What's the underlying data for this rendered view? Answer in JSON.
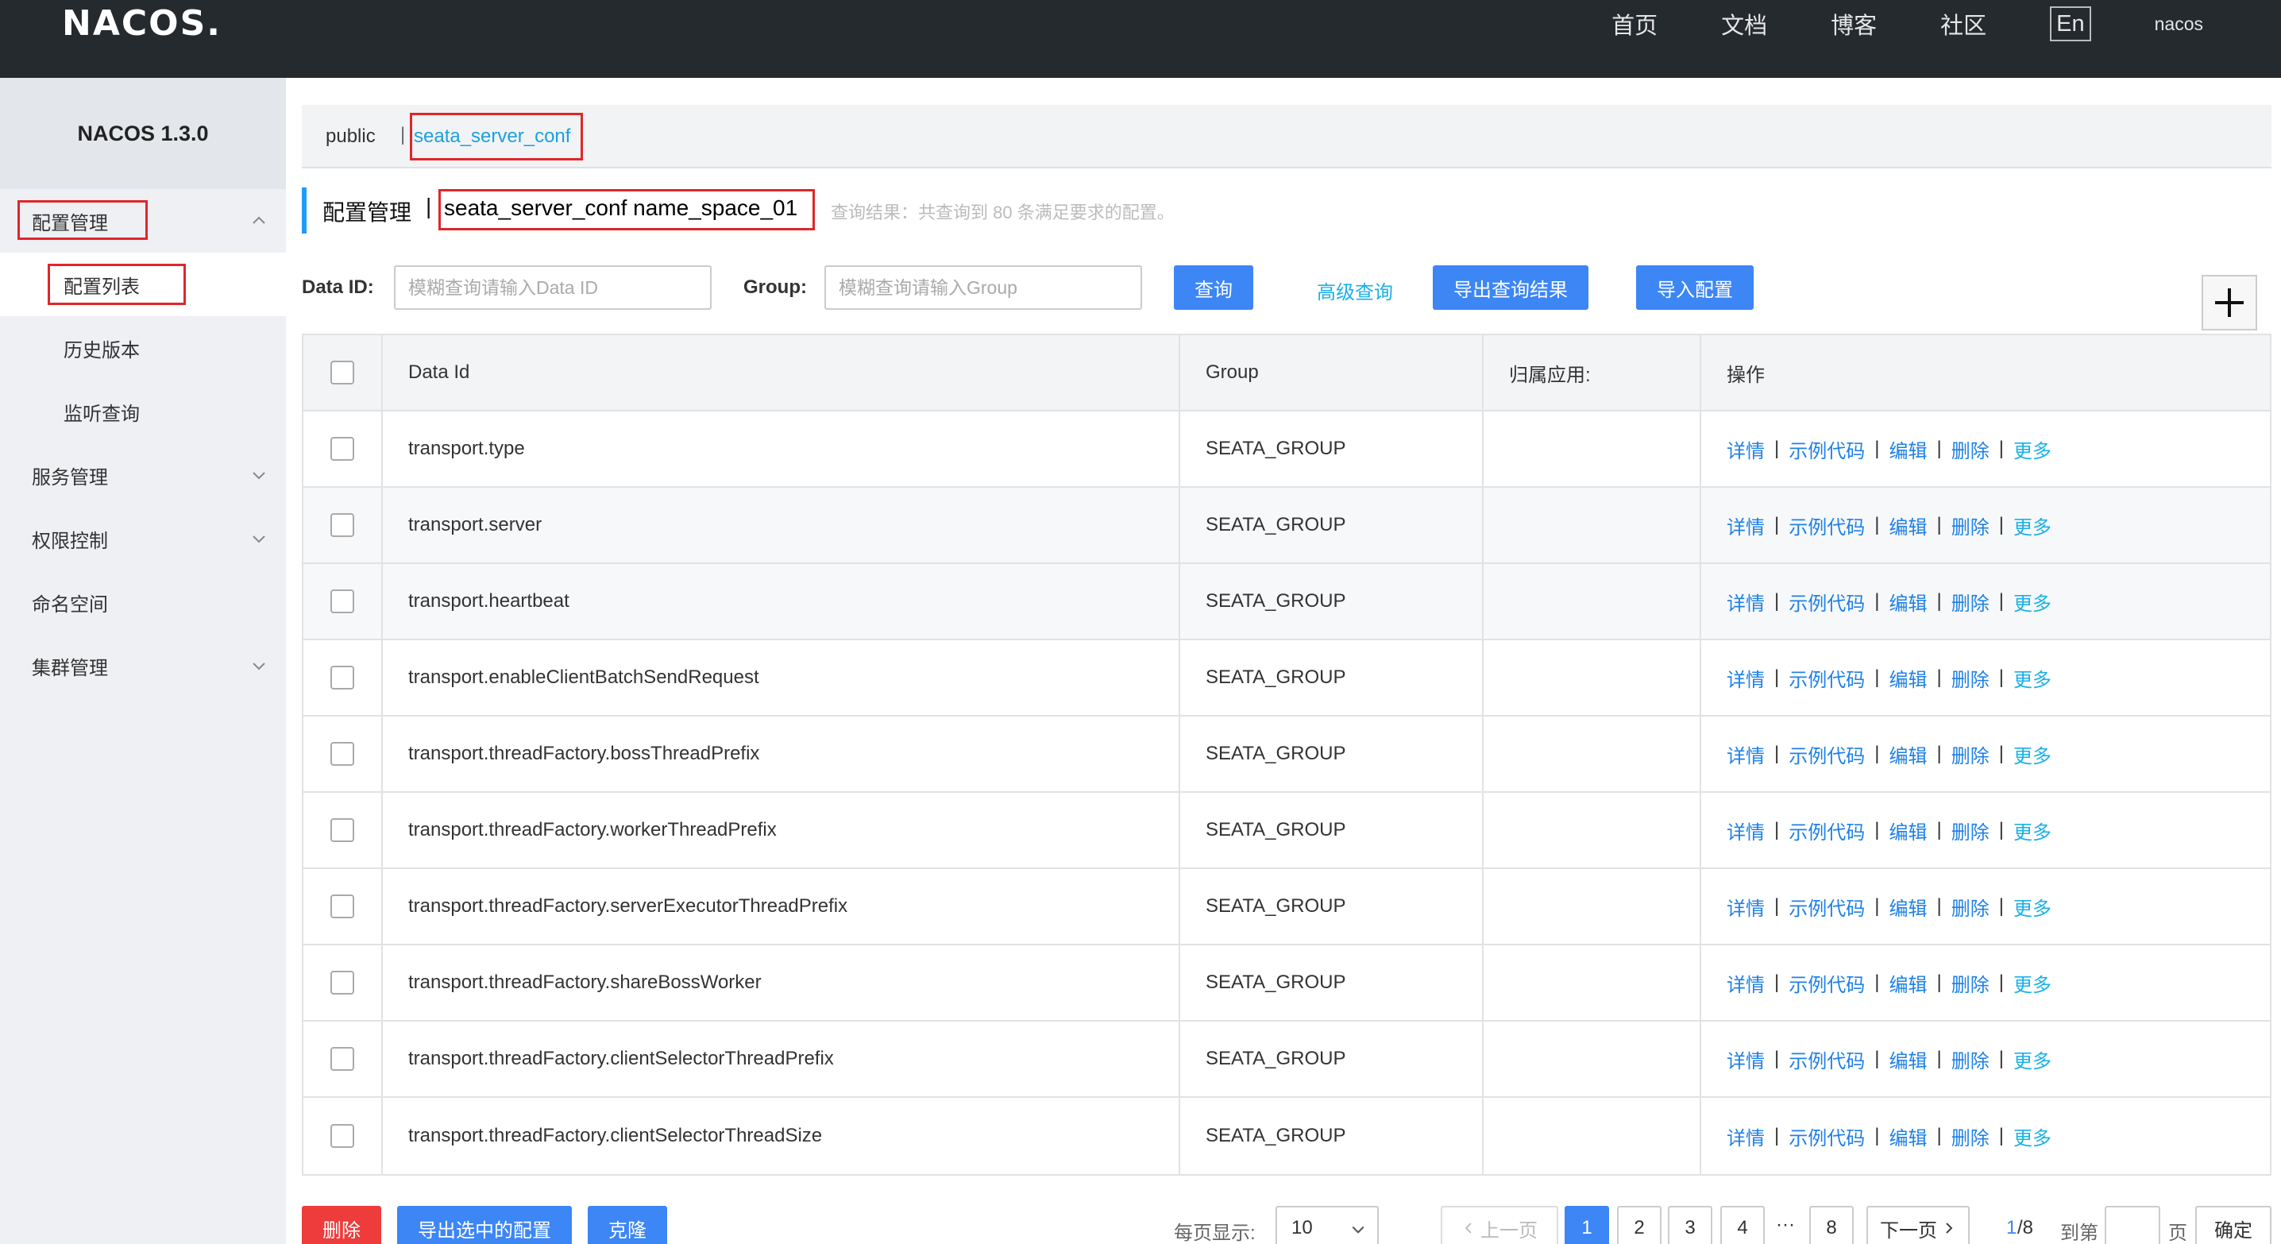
{
  "topbar": {
    "logo": "NACOS.",
    "nav": [
      "首页",
      "文档",
      "博客",
      "社区"
    ],
    "lang": "En",
    "user": "nacos"
  },
  "sidebar": {
    "version": "NACOS 1.3.0",
    "items": [
      {
        "label": "配置管理",
        "type": "group",
        "expanded": true
      },
      {
        "label": "配置列表",
        "type": "sub",
        "active": true
      },
      {
        "label": "历史版本",
        "type": "sub"
      },
      {
        "label": "监听查询",
        "type": "sub"
      },
      {
        "label": "服务管理",
        "type": "group",
        "expanded": false
      },
      {
        "label": "权限控制",
        "type": "group",
        "expanded": false
      },
      {
        "label": "命名空间",
        "type": "plain"
      },
      {
        "label": "集群管理",
        "type": "group",
        "expanded": false
      }
    ]
  },
  "namespace": {
    "public": "public",
    "separator": "|",
    "current": "seata_server_conf"
  },
  "title": {
    "label": "配置管理",
    "separator": "|",
    "namespace": "seata_server_conf  name_space_01",
    "result": "查询结果：共查询到 80 条满足要求的配置。"
  },
  "search": {
    "dataid_label": "Data ID:",
    "dataid_placeholder": "模糊查询请输入Data ID",
    "group_label": "Group:",
    "group_placeholder": "模糊查询请输入Group",
    "query_btn": "查询",
    "advanced": "高级查询",
    "export_btn": "导出查询结果",
    "import_btn": "导入配置"
  },
  "table": {
    "headers": [
      "Data Id",
      "Group",
      "归属应用:",
      "操作"
    ],
    "ops": [
      "详情",
      "示例代码",
      "编辑",
      "删除",
      "更多"
    ],
    "rows": [
      {
        "data_id": "transport.type",
        "group": "SEATA_GROUP",
        "app": ""
      },
      {
        "data_id": "transport.server",
        "group": "SEATA_GROUP",
        "app": ""
      },
      {
        "data_id": "transport.heartbeat",
        "group": "SEATA_GROUP",
        "app": ""
      },
      {
        "data_id": "transport.enableClientBatchSendRequest",
        "group": "SEATA_GROUP",
        "app": ""
      },
      {
        "data_id": "transport.threadFactory.bossThreadPrefix",
        "group": "SEATA_GROUP",
        "app": ""
      },
      {
        "data_id": "transport.threadFactory.workerThreadPrefix",
        "group": "SEATA_GROUP",
        "app": ""
      },
      {
        "data_id": "transport.threadFactory.serverExecutorThreadPrefix",
        "group": "SEATA_GROUP",
        "app": ""
      },
      {
        "data_id": "transport.threadFactory.shareBossWorker",
        "group": "SEATA_GROUP",
        "app": ""
      },
      {
        "data_id": "transport.threadFactory.clientSelectorThreadPrefix",
        "group": "SEATA_GROUP",
        "app": ""
      },
      {
        "data_id": "transport.threadFactory.clientSelectorThreadSize",
        "group": "SEATA_GROUP",
        "app": ""
      }
    ]
  },
  "bottom": {
    "delete_btn": "删除",
    "export_selected_btn": "导出选中的配置",
    "clone_btn": "克隆",
    "page_size_label": "每页显示:",
    "page_size": "10",
    "prev": "上一页",
    "pages": [
      "1",
      "2",
      "3",
      "4"
    ],
    "ellipsis": "···",
    "last_page": "8",
    "next": "下一页",
    "current_page": "1",
    "page_total": "/8",
    "goto_label": "到第",
    "goto_suffix": "页",
    "confirm": "确定"
  },
  "colors": {
    "topbar": "#252a2f",
    "primary": "#3c86f6",
    "danger": "#ee3b3b",
    "link": "#1e80e8",
    "highlight_box": "#e0262b"
  }
}
